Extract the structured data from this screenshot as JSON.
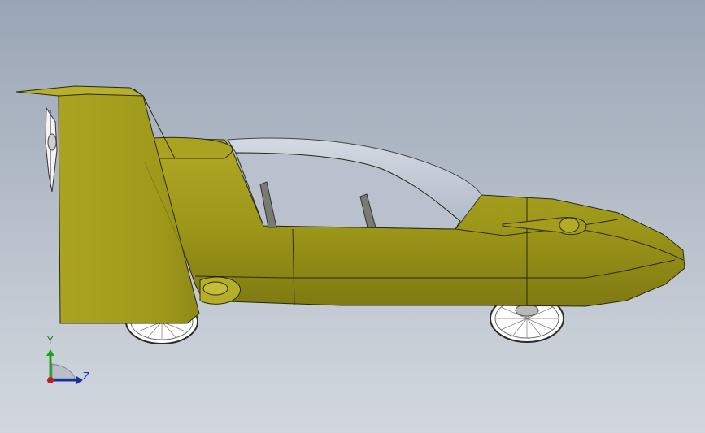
{
  "viewport": {
    "background_top": "#9aa5b5",
    "background_bottom": "#d2d7de",
    "model": "flying-car"
  },
  "model_colors": {
    "body": "#a09a1a",
    "body_shadow": "#8a8414",
    "canopy": "#c8d0dc",
    "edge": "#2b2a10"
  },
  "triad": {
    "y_label": "Y",
    "z_label": "Z",
    "y_color": "#1fa01f",
    "z_color": "#1b2fa5",
    "origin_color": "#c0201c"
  }
}
